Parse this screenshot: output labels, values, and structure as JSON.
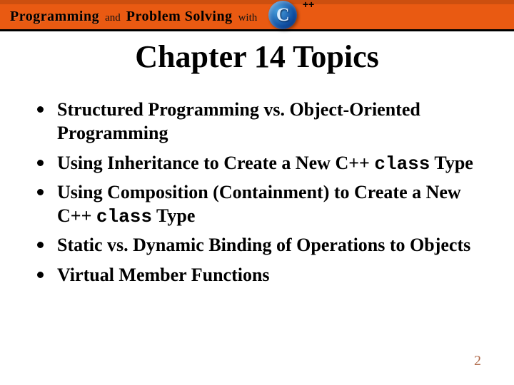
{
  "banner": {
    "word1": "Programming",
    "word2": "and",
    "word3": "Problem Solving",
    "word4": "with",
    "cpp_plus": "++"
  },
  "title": "Chapter 14 Topics",
  "topics": [
    {
      "pre": "Structured Programming vs. Object-Oriented Programming",
      "code": "",
      "post": ""
    },
    {
      "pre": "Using Inheritance to Create a New C++ ",
      "code": "class",
      "post": " Type"
    },
    {
      "pre": "Using Composition (Containment) to Create a New C++ ",
      "code": "class",
      "post": " Type"
    },
    {
      "pre": "Static vs. Dynamic Binding of Operations to Objects",
      "code": "",
      "post": ""
    },
    {
      "pre": "Virtual Member Functions",
      "code": "",
      "post": ""
    }
  ],
  "page_number": "2"
}
